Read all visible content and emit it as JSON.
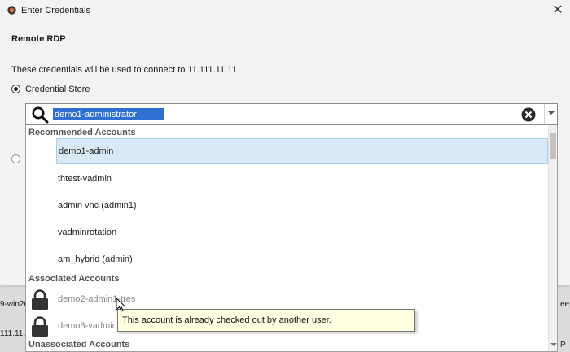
{
  "window": {
    "title": "Enter Credentials"
  },
  "section": {
    "title": "Remote RDP"
  },
  "info_text": "These credentials will be used to connect to 11.111.11.11",
  "credential_store": {
    "label": "Credential Store",
    "selected": true
  },
  "combo": {
    "value": "demo1-administrator"
  },
  "dropdown": {
    "groups": [
      {
        "header": "Recommended Accounts",
        "items": [
          "demo1-admin",
          "thtest-vadmin",
          "admin vnc (admin1)",
          "vadminrotation",
          "am_hybrid (admin)"
        ]
      },
      {
        "header": "Associated Accounts",
        "items": [
          "demo2-admin1-tres",
          "demo3-vadmin"
        ]
      },
      {
        "header": "Unassociated Accounts",
        "items": []
      }
    ]
  },
  "tooltip": "This account is already checked out by another user.",
  "background": {
    "left_frag_1": "9-win20",
    "left_frag_2": "111.11.11",
    "right_frag_1": "ee",
    "right_frag_2": "P"
  },
  "icons": [
    "close-icon",
    "search-icon",
    "clear-icon",
    "chevron-down-icon",
    "lock-icon"
  ],
  "colors": {
    "selection": "#2f6fd1",
    "hover_row": "#d9eaf6",
    "tooltip_bg": "#ffffe1"
  }
}
